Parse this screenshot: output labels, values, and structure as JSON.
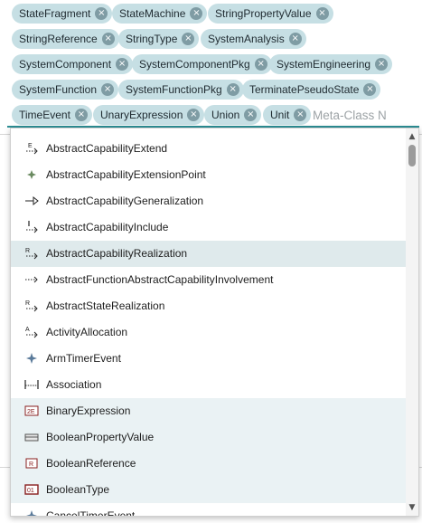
{
  "chips": [
    {
      "label": "StateFragment"
    },
    {
      "label": "StateMachine"
    },
    {
      "label": "StringPropertyValue"
    },
    {
      "label": "StringReference"
    },
    {
      "label": "StringType"
    },
    {
      "label": "SystemAnalysis"
    },
    {
      "label": "SystemComponent"
    },
    {
      "label": "SystemComponentPkg"
    },
    {
      "label": "SystemEngineering"
    },
    {
      "label": "SystemFunction"
    },
    {
      "label": "SystemFunctionPkg"
    },
    {
      "label": "TerminatePseudoState"
    },
    {
      "label": "TimeEvent"
    },
    {
      "label": "UnaryExpression"
    },
    {
      "label": "Union"
    },
    {
      "label": "Unit"
    }
  ],
  "chip_remove_glyph": "×",
  "search": {
    "placeholder": "Meta-Class N",
    "value": ""
  },
  "options": [
    {
      "label": "AbstractCapabilityExtend",
      "icon": "extend-icon"
    },
    {
      "label": "AbstractCapabilityExtensionPoint",
      "icon": "extension-point-icon"
    },
    {
      "label": "AbstractCapabilityGeneralization",
      "icon": "generalization-icon"
    },
    {
      "label": "AbstractCapabilityInclude",
      "icon": "include-icon"
    },
    {
      "label": "AbstractCapabilityRealization",
      "icon": "realization-icon",
      "state": "hovered"
    },
    {
      "label": "AbstractFunctionAbstractCapabilityInvolvement",
      "icon": "involvement-icon"
    },
    {
      "label": "AbstractStateRealization",
      "icon": "realization-icon"
    },
    {
      "label": "ActivityAllocation",
      "icon": "allocation-icon"
    },
    {
      "label": "ArmTimerEvent",
      "icon": "timer-event-icon"
    },
    {
      "label": "Association",
      "icon": "association-icon"
    },
    {
      "label": "BinaryExpression",
      "icon": "binary-expression-icon"
    },
    {
      "label": "BooleanPropertyValue",
      "icon": "property-value-icon"
    },
    {
      "label": "BooleanReference",
      "icon": "reference-icon"
    },
    {
      "label": "BooleanType",
      "icon": "boolean-type-icon"
    },
    {
      "label": "CancelTimerEvent",
      "icon": "timer-event-icon"
    }
  ],
  "scrollbar": {
    "up_glyph": "▲",
    "down_glyph": "▼"
  },
  "colors": {
    "chip_bg": "#c6dfe4",
    "accent": "#2c8f95",
    "hover_row": "#dfeaec",
    "selected_row": "#eaf2f4"
  }
}
